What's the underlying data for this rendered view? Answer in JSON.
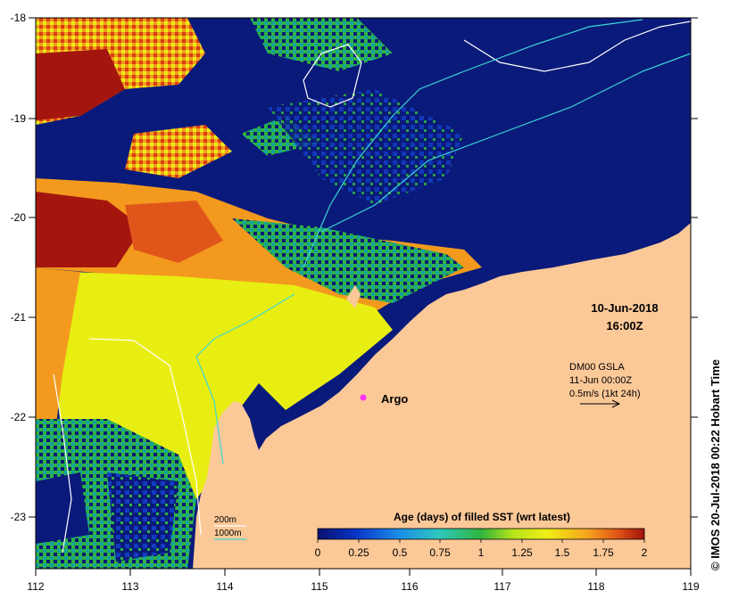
{
  "map": {
    "x_axis_ticks": [
      "112",
      "113",
      "114",
      "115",
      "116",
      "117",
      "118",
      "119"
    ],
    "y_axis_ticks": [
      "-18",
      "-19",
      "-20",
      "-21",
      "-22",
      "-23"
    ],
    "date_label": "10-Jun-2018",
    "time_label": "16:00Z",
    "argo_label": "Argo",
    "vector_title": "DM00 GSLA",
    "vector_date": "11-Jun 00:00Z",
    "vector_scale": "0.5m/s (1kt 24h)",
    "contour_200": "200m",
    "contour_1000": "1000m",
    "colorbar_title": "Age (days) of filled SST (wrt latest)",
    "colorbar_ticks": [
      "0",
      "0.25",
      "0.5",
      "0.75",
      "1",
      "1.25",
      "1.5",
      "1.75",
      "2"
    ],
    "credit": "© IMOS 20-Jul-2018 00:22 Hobart Time",
    "colors": {
      "land": "#fbc898",
      "deep_blue": "#0a1a7a",
      "yellow": "#e8ee12",
      "orange": "#f39a1e",
      "dark_red": "#a4150e",
      "green": "#2fb43c",
      "contour_200": "#ffffff",
      "contour_1000": "#3ad6d6",
      "argo": "#ff33ff"
    }
  }
}
